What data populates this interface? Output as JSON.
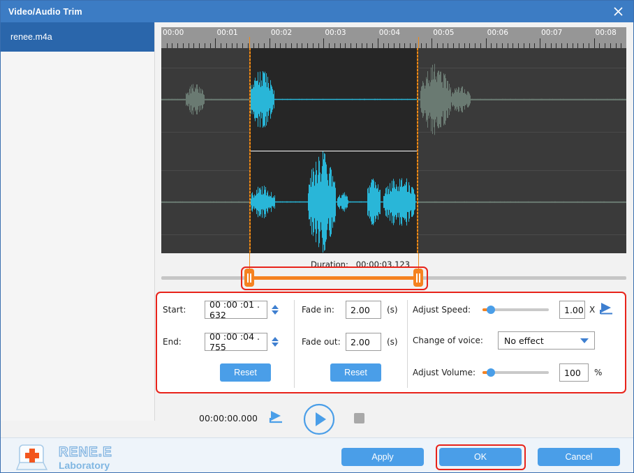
{
  "window": {
    "title": "Video/Audio Trim",
    "close_icon": "close-icon"
  },
  "sidebar": {
    "files": [
      {
        "name": "renee.m4a",
        "selected": true
      }
    ]
  },
  "timeline": {
    "ruler_labels": [
      "00:00",
      "00:01",
      "00:02",
      "00:03",
      "00:04",
      "00:05",
      "00:06",
      "00:07",
      "00:08"
    ],
    "duration_label": "Duration:",
    "duration_value": "00:00:03.123",
    "selection_start_seconds": 1.632,
    "selection_end_seconds": 4.755,
    "visible_span_seconds": 8.6,
    "marker_color": "#f58220",
    "waveform_color_selected": "#29b6d8",
    "waveform_color_unselected": "#6a7a72",
    "panel_background": "#3a3a3a",
    "selection_background": "#262626"
  },
  "trim": {
    "start_label": "Start:",
    "start_value": "00 :00 :01 . 632",
    "end_label": "End:",
    "end_value": "00 :00 :04 . 755",
    "reset_label": "Reset"
  },
  "fade": {
    "fade_in_label": "Fade in:",
    "fade_in_value": "2.00",
    "fade_out_label": "Fade out:",
    "fade_out_value": "2.00",
    "seconds_unit": "(s)",
    "reset_label": "Reset"
  },
  "effects": {
    "speed_label": "Adjust Speed:",
    "speed_value": "1.00",
    "speed_unit": "X",
    "speed_slider_percent": 12,
    "speed_preview_icon": "play-preview-icon",
    "voice_label": "Change of voice:",
    "voice_value": "No effect",
    "voice_options": [
      "No effect"
    ],
    "volume_label": "Adjust Volume:",
    "volume_value": "100",
    "volume_unit": "%",
    "volume_slider_percent": 12
  },
  "transport": {
    "current_time": "00:00:00.000",
    "preview_play_icon": "play-preview-icon",
    "play_icon": "play-circle-icon",
    "stop_icon": "stop-icon"
  },
  "footer": {
    "logo_main": "RENE.E",
    "logo_sub": "Laboratory",
    "logo_icon": "renee-key-plus-icon",
    "apply_label": "Apply",
    "ok_label": "OK",
    "cancel_label": "Cancel"
  },
  "annotations": {
    "highlight_color": "#e8231a",
    "highlighted": [
      "range-slider",
      "controls-panel",
      "ok-button"
    ]
  }
}
